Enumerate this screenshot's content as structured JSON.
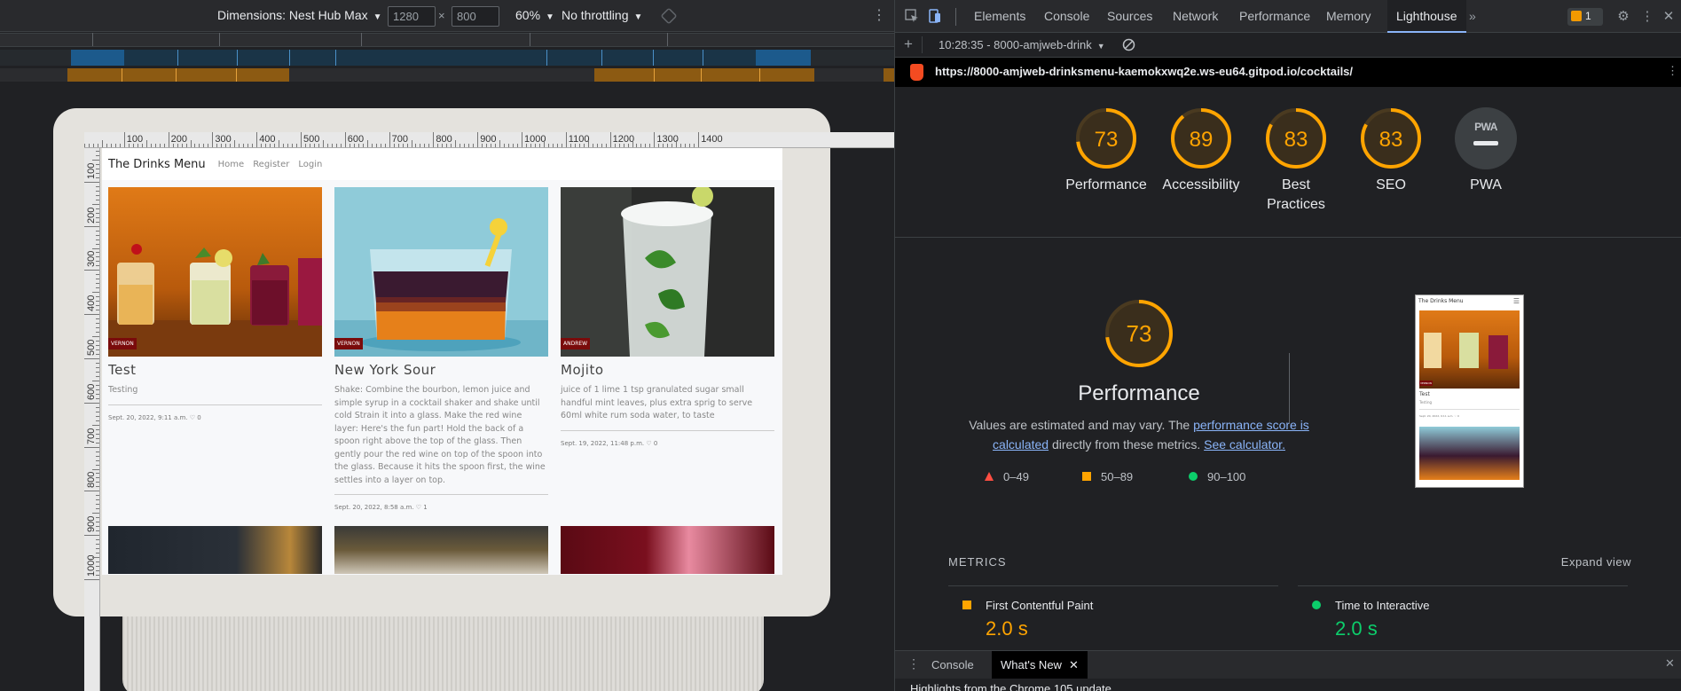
{
  "device_toolbar": {
    "device_label": "Dimensions: Nest Hub Max",
    "width_value": "1280",
    "height_value": "800",
    "times_symbol": "×",
    "zoom_label": "60%",
    "throttling_label": "No throttling"
  },
  "ruler": {
    "top_labels": [
      "100",
      "200",
      "300",
      "400",
      "500",
      "600",
      "700",
      "800",
      "900",
      "1000",
      "1100",
      "1200",
      "1300",
      "1400"
    ],
    "left_labels": [
      "100",
      "200",
      "300",
      "400",
      "500",
      "600",
      "700",
      "800",
      "900",
      "1000"
    ]
  },
  "site": {
    "brand": "The Drinks Menu",
    "nav": [
      "Home",
      "Register",
      "Login"
    ],
    "cards": [
      {
        "badge": "VERNON",
        "title": "Test",
        "description": "Testing",
        "meta": "Sept. 20, 2022, 9:11 a.m. ♡ 0"
      },
      {
        "badge": "VERNON",
        "title": "New York Sour",
        "description": "Shake: Combine the bourbon, lemon juice and simple syrup in a cocktail shaker and shake until cold Strain it into a glass. Make the red wine layer: Here's the fun part! Hold the back of a spoon right above the top of the glass. Then gently pour the red wine on top of the spoon into the glass. Because it hits the spoon first, the wine settles into a layer on top.",
        "meta": "Sept. 20, 2022, 8:58 a.m. ♡ 1"
      },
      {
        "badge": "ANDREW",
        "title": "Mojito",
        "description": "juice of 1 lime 1 tsp granulated sugar small handful mint leaves, plus extra sprig to serve 60ml white rum soda water, to taste",
        "meta": "Sept. 19, 2022, 11:48 p.m. ♡ 0"
      }
    ]
  },
  "devtools": {
    "tabs": [
      "Elements",
      "Console",
      "Sources",
      "Network",
      "Performance",
      "Memory",
      "Lighthouse"
    ],
    "active_tab": "Lighthouse",
    "more_tabs": "»",
    "issues_count": "1",
    "report_label": "10:28:35 - 8000-amjweb-drink",
    "add_label": "+",
    "url": "https://8000-amjweb-drinksmenu-kaemokxwq2e.ws-eu64.gitpod.io/cocktails/",
    "categories": [
      {
        "label": "Performance",
        "score": 73
      },
      {
        "label": "Accessibility",
        "score": 89
      },
      {
        "label": "Best Practices",
        "score": 83
      },
      {
        "label": "SEO",
        "score": 83
      },
      {
        "label": "PWA",
        "score": null
      }
    ],
    "pwa_badge": "PWA",
    "performance": {
      "score": "73",
      "title": "Performance",
      "desc_prefix": "Values are estimated and may vary. The ",
      "desc_link": "performance score is calculated",
      "desc_mid": " directly from these metrics. ",
      "desc_link2": "See calculator."
    },
    "legend": [
      {
        "range": "0–49",
        "shape": "triangle",
        "color": "#ff4e42"
      },
      {
        "range": "50–89",
        "shape": "square",
        "color": "#ffa400"
      },
      {
        "range": "90–100",
        "shape": "circle",
        "color": "#0cce6b"
      }
    ],
    "thumbnail": {
      "brand": "The Drinks Menu",
      "title": "Test",
      "desc": "Testing",
      "meta": "Sept. 20, 2022, 9:11 a.m. ♡ 0",
      "badge": "VERNON"
    },
    "metrics": {
      "title": "METRICS",
      "expand": "Expand view",
      "items": [
        {
          "name": "First Contentful Paint",
          "value": "2.0 s",
          "color": "#ffa400"
        },
        {
          "name": "Time to Interactive",
          "value": "2.0 s",
          "color": "#0cce6b"
        }
      ]
    },
    "drawer": {
      "tabs": [
        "Console",
        "What's New"
      ],
      "active": "What's New",
      "body": "Highlights from the Chrome 105 update"
    }
  },
  "colors": {
    "average": "#ffa400",
    "pass": "#0cce6b",
    "fail": "#ff4e42",
    "accent": "#8ab4f8"
  }
}
